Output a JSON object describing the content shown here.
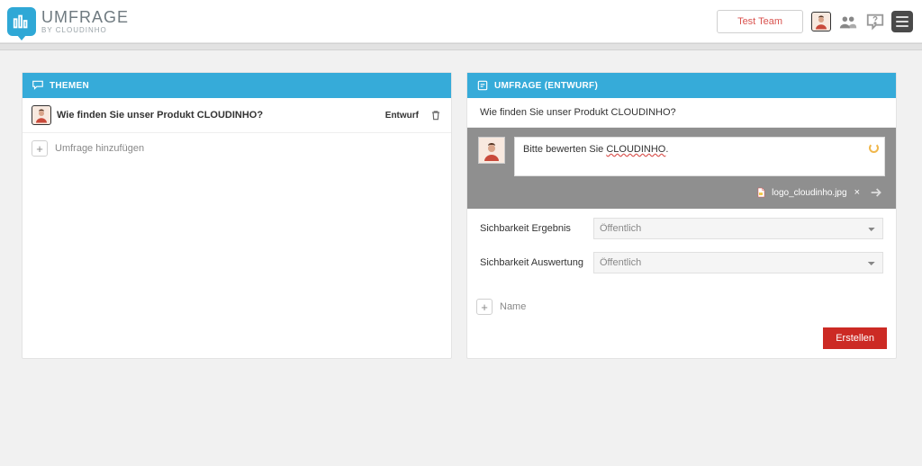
{
  "brand": {
    "title": "UMFRAGE",
    "subtitle": "BY CLOUDINHO"
  },
  "header": {
    "team_button": "Test Team"
  },
  "left_panel": {
    "heading": "THEMEN",
    "items": [
      {
        "title": "Wie finden Sie unser Produkt CLOUDINHO?",
        "status": "Entwurf"
      }
    ],
    "add_label": "Umfrage hinzufügen"
  },
  "right_panel": {
    "heading": "UMFRAGE (ENTWURF)",
    "question": "Wie finden Sie unser Produkt CLOUDINHO?",
    "compose_prefix": "Bitte bewerten Sie ",
    "compose_underlined": "CLOUDINHO",
    "compose_suffix": ".",
    "attachment": "logo_cloudinho.jpg",
    "visibility_result_label": "Sichbarkeit Ergebnis",
    "visibility_eval_label": "Sichbarkeit Auswertung",
    "visibility_result_value": "Öffentlich",
    "visibility_eval_value": "Öffentlich",
    "visibility_options": [
      "Öffentlich"
    ],
    "name_label": "Name",
    "create_button": "Erstellen"
  }
}
